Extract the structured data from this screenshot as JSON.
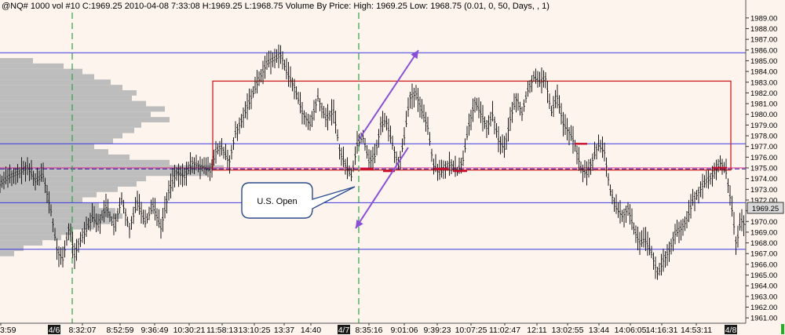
{
  "header": {
    "text": "@NQ#  1000 vol  #10  C:1969.25  2010-04-08  7:33:08  H:1969.25  L:1968.75  Volume By Price:  High: 1969.25  Low: 1968.75   (0.01, 0, 50, Days, , 1)"
  },
  "chart_data": {
    "type": "candlestick",
    "ylim": [
      1960.5,
      1989.5
    ],
    "y_tick_values": [
      1961,
      1962,
      1963,
      1964,
      1965,
      1966,
      1967,
      1968,
      1969,
      1970,
      1971,
      1972,
      1973,
      1974,
      1975,
      1976,
      1977,
      1978,
      1979,
      1980,
      1981,
      1982,
      1983,
      1984,
      1985,
      1986,
      1987,
      1988,
      1989
    ],
    "y_tick_labels": [
      "1961.00",
      "1962.00",
      "1963.00",
      "1964.00",
      "1965.00",
      "1966.00",
      "1967.00",
      "1968.00",
      "1969.00",
      "1970.00",
      "1971.00",
      "1972.00",
      "1973.00",
      "1974.00",
      "1975.00",
      "1976.00",
      "1977.00",
      "1978.00",
      "1979.00",
      "1980.00",
      "1981.00",
      "1982.00",
      "1983.00",
      "1984.00",
      "1985.00",
      "1986.00",
      "1987.00",
      "1988.00",
      "1989.00"
    ],
    "x_tick_labels": [
      {
        "label": "3:59",
        "date_marker": false
      },
      {
        "label": "4/6",
        "date_marker": true
      },
      {
        "label": "8:32:07",
        "date_marker": false
      },
      {
        "label": "8:52:59",
        "date_marker": false
      },
      {
        "label": "9:36:49",
        "date_marker": false
      },
      {
        "label": "10:30:21",
        "date_marker": false
      },
      {
        "label": "11:58:13",
        "date_marker": false
      },
      {
        "label": "13:10:25",
        "date_marker": false
      },
      {
        "label": "13:37",
        "date_marker": false
      },
      {
        "label": "14:40",
        "date_marker": false
      },
      {
        "label": "4/7",
        "date_marker": true
      },
      {
        "label": "8:35:16",
        "date_marker": false
      },
      {
        "label": "9:01:06",
        "date_marker": false
      },
      {
        "label": "9:39:23",
        "date_marker": false
      },
      {
        "label": "10:07:25",
        "date_marker": false
      },
      {
        "label": "11:02:47",
        "date_marker": false
      },
      {
        "label": "12:11",
        "date_marker": false
      },
      {
        "label": "13:02:55",
        "date_marker": false
      },
      {
        "label": "13:44",
        "date_marker": false
      },
      {
        "label": "14:06:05",
        "date_marker": false
      },
      {
        "label": "14:16:31",
        "date_marker": false
      },
      {
        "label": "14:53:11",
        "date_marker": false
      },
      {
        "label": "4/8",
        "date_marker": true
      }
    ],
    "last_price": "1969.25",
    "horizontal_levels": [
      {
        "price": 1985.75,
        "color": "#3a3ae0",
        "style": "solid"
      },
      {
        "price": 1977.25,
        "color": "#3a3ae0",
        "style": "solid"
      },
      {
        "price": 1971.75,
        "color": "#3a3ae0",
        "style": "solid"
      },
      {
        "price": 1967.4,
        "color": "#3a3ae0",
        "style": "solid"
      },
      {
        "price": 1974.9,
        "color": "#2a2aa0",
        "style": "dashed"
      },
      {
        "price": 1975.0,
        "color": "#e0208a",
        "style": "solid"
      }
    ],
    "session_lines": [
      {
        "label": "4/6"
      },
      {
        "label": "4/7"
      }
    ],
    "range_box": {
      "price_high": 1983.1,
      "price_low": 1974.8,
      "color": "#cc2020"
    },
    "annotation": {
      "text": "U.S. Open"
    },
    "price_path": [
      [
        0,
        1973.5
      ],
      [
        12,
        1974.2
      ],
      [
        25,
        1974.6
      ],
      [
        35,
        1975.1
      ],
      [
        45,
        1973.8
      ],
      [
        55,
        1974.3
      ],
      [
        65,
        1971.0
      ],
      [
        73,
        1967.2
      ],
      [
        80,
        1966.5
      ],
      [
        88,
        1969.5
      ],
      [
        95,
        1966.8
      ],
      [
        100,
        1968.0
      ],
      [
        110,
        1969.2
      ],
      [
        118,
        1970.5
      ],
      [
        125,
        1969.6
      ],
      [
        135,
        1971.4
      ],
      [
        145,
        1969.6
      ],
      [
        155,
        1972.0
      ],
      [
        165,
        1969.4
      ],
      [
        175,
        1971.8
      ],
      [
        185,
        1969.9
      ],
      [
        195,
        1971.5
      ],
      [
        205,
        1969.4
      ],
      [
        215,
        1972.8
      ],
      [
        225,
        1974.6
      ],
      [
        235,
        1974.2
      ],
      [
        245,
        1975.5
      ],
      [
        255,
        1975.2
      ],
      [
        268,
        1974.7
      ],
      [
        275,
        1976.6
      ],
      [
        282,
        1977.0
      ],
      [
        292,
        1975.5
      ],
      [
        300,
        1978.3
      ],
      [
        310,
        1979.8
      ],
      [
        320,
        1981.6
      ],
      [
        330,
        1983.3
      ],
      [
        340,
        1984.8
      ],
      [
        350,
        1985.2
      ],
      [
        358,
        1985.6
      ],
      [
        365,
        1984.0
      ],
      [
        375,
        1982.6
      ],
      [
        385,
        1980.2
      ],
      [
        395,
        1979.1
      ],
      [
        405,
        1981.6
      ],
      [
        415,
        1979.6
      ],
      [
        425,
        1980.3
      ],
      [
        433,
        1976.5
      ],
      [
        440,
        1975.3
      ],
      [
        448,
        1974.2
      ],
      [
        455,
        1977.2
      ],
      [
        462,
        1978.0
      ],
      [
        470,
        1975.6
      ],
      [
        478,
        1976.2
      ],
      [
        485,
        1979.0
      ],
      [
        492,
        1979.4
      ],
      [
        500,
        1977.2
      ],
      [
        508,
        1975.1
      ],
      [
        515,
        1977.9
      ],
      [
        522,
        1981.6
      ],
      [
        530,
        1982.0
      ],
      [
        538,
        1980.2
      ],
      [
        545,
        1978.8
      ],
      [
        552,
        1975.3
      ],
      [
        560,
        1974.5
      ],
      [
        568,
        1975.2
      ],
      [
        575,
        1975.4
      ],
      [
        582,
        1974.6
      ],
      [
        590,
        1975.8
      ],
      [
        597,
        1978.9
      ],
      [
        605,
        1981.2
      ],
      [
        612,
        1980.2
      ],
      [
        620,
        1978.8
      ],
      [
        628,
        1980.1
      ],
      [
        635,
        1977.6
      ],
      [
        643,
        1976.8
      ],
      [
        650,
        1979.6
      ],
      [
        658,
        1981.6
      ],
      [
        665,
        1980.1
      ],
      [
        672,
        1982.2
      ],
      [
        680,
        1983.5
      ],
      [
        688,
        1983.0
      ],
      [
        695,
        1983.4
      ],
      [
        702,
        1980.2
      ],
      [
        710,
        1981.6
      ],
      [
        718,
        1979.0
      ],
      [
        725,
        1978.4
      ],
      [
        732,
        1977.3
      ],
      [
        740,
        1975.0
      ],
      [
        747,
        1974.4
      ],
      [
        755,
        1975.8
      ],
      [
        762,
        1977.2
      ],
      [
        770,
        1976.5
      ],
      [
        777,
        1973.0
      ],
      [
        785,
        1971.3
      ],
      [
        793,
        1970.5
      ],
      [
        800,
        1971.3
      ],
      [
        808,
        1969.2
      ],
      [
        815,
        1968.0
      ],
      [
        822,
        1968.3
      ],
      [
        830,
        1967.0
      ],
      [
        838,
        1965.1
      ],
      [
        845,
        1966.4
      ],
      [
        853,
        1967.4
      ],
      [
        860,
        1968.9
      ],
      [
        868,
        1969.4
      ],
      [
        875,
        1970.2
      ],
      [
        883,
        1972.0
      ],
      [
        890,
        1972.8
      ],
      [
        897,
        1973.6
      ],
      [
        905,
        1974.1
      ],
      [
        912,
        1974.8
      ],
      [
        918,
        1975.6
      ],
      [
        925,
        1974.6
      ],
      [
        932,
        1971.4
      ],
      [
        938,
        1967.8
      ],
      [
        944,
        1970.2
      ],
      [
        950,
        1969.6
      ],
      [
        955,
        1969.25
      ]
    ],
    "volume_profile": [
      {
        "price": 1985.0,
        "extent": 0.14
      },
      {
        "price": 1984.5,
        "extent": 0.27
      },
      {
        "price": 1984.0,
        "extent": 0.35
      },
      {
        "price": 1983.5,
        "extent": 0.4
      },
      {
        "price": 1983.0,
        "extent": 0.47
      },
      {
        "price": 1982.5,
        "extent": 0.52
      },
      {
        "price": 1982.0,
        "extent": 0.58
      },
      {
        "price": 1981.5,
        "extent": 0.56
      },
      {
        "price": 1981.0,
        "extent": 0.62
      },
      {
        "price": 1980.5,
        "extent": 0.7
      },
      {
        "price": 1980.0,
        "extent": 0.64
      },
      {
        "price": 1979.5,
        "extent": 0.72
      },
      {
        "price": 1979.0,
        "extent": 0.6
      },
      {
        "price": 1978.5,
        "extent": 0.57
      },
      {
        "price": 1978.0,
        "extent": 0.52
      },
      {
        "price": 1977.5,
        "extent": 0.48
      },
      {
        "price": 1977.0,
        "extent": 0.4
      },
      {
        "price": 1976.5,
        "extent": 0.46
      },
      {
        "price": 1976.0,
        "extent": 0.55
      },
      {
        "price": 1975.5,
        "extent": 0.72
      },
      {
        "price": 1975.0,
        "extent": 0.95
      },
      {
        "price": 1974.5,
        "extent": 0.88
      },
      {
        "price": 1974.0,
        "extent": 0.62
      },
      {
        "price": 1973.5,
        "extent": 0.58
      },
      {
        "price": 1973.0,
        "extent": 0.5
      },
      {
        "price": 1972.5,
        "extent": 0.41
      },
      {
        "price": 1972.0,
        "extent": 0.35
      },
      {
        "price": 1971.5,
        "extent": 0.42
      },
      {
        "price": 1971.0,
        "extent": 0.49
      },
      {
        "price": 1970.5,
        "extent": 0.52
      },
      {
        "price": 1970.0,
        "extent": 0.47
      },
      {
        "price": 1969.5,
        "extent": 0.4
      },
      {
        "price": 1969.0,
        "extent": 0.31
      },
      {
        "price": 1968.5,
        "extent": 0.26
      },
      {
        "price": 1968.0,
        "extent": 0.18
      },
      {
        "price": 1967.5,
        "extent": 0.1
      },
      {
        "price": 1967.0,
        "extent": 0.06
      }
    ]
  },
  "colors": {
    "background": "#fdf4ee",
    "profile": "#bdbdbd",
    "bars": "#1a1a1a",
    "session_line": "#2ea043",
    "arrow": "#8a4fd6",
    "price_tag": "#d8d8d8"
  }
}
